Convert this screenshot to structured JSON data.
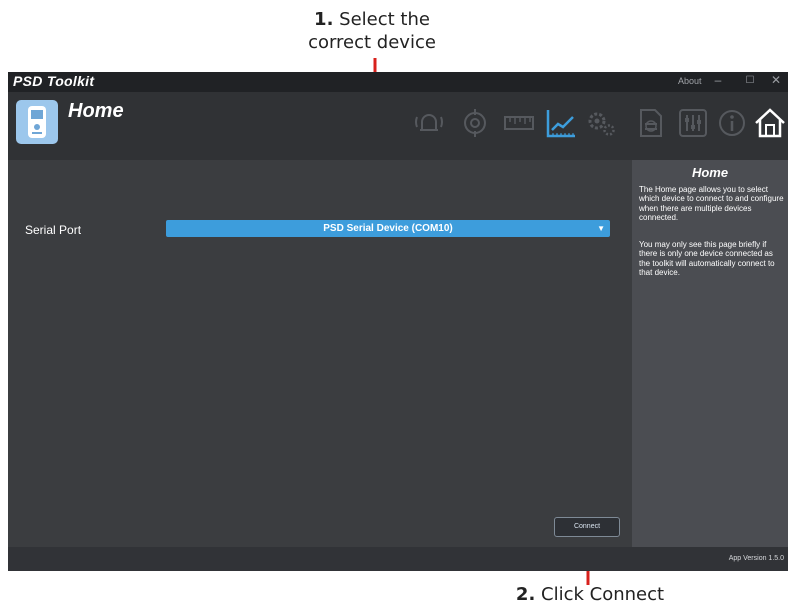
{
  "annotations": {
    "top_step": "1.",
    "top_line1": " Select the",
    "top_line2": "correct device",
    "bottom_step": "2.",
    "bottom_text": " Click Connect"
  },
  "app": {
    "title": "PSD Toolkit",
    "about": "About",
    "minimize_glyph": "–",
    "maximize_glyph": "☐",
    "close_glyph": "✕",
    "page_title": "Home",
    "version": "App Version 1.5.0"
  },
  "toolbar": {
    "icons": [
      "alarm-icon",
      "target-icon",
      "ruler-icon",
      "chart-icon",
      "gears-icon",
      "document-icon",
      "sliders-icon",
      "info-icon",
      "home-icon"
    ]
  },
  "main": {
    "serial_label": "Serial Port",
    "serial_value": "PSD Serial Device (COM10)",
    "connect_label": "Connect"
  },
  "help": {
    "title": "Home",
    "paragraph1": "The Home page allows you to select which device to connect to and configure when there are multiple devices connected.",
    "paragraph2": "You may only see this page briefly if there is only one device connected as the toolkit will automatically connect to that device."
  },
  "colors": {
    "accent_select": "#3d9ddc",
    "arrow": "#d8211c",
    "background": "#3b3d40",
    "side_panel": "#4b4d52"
  }
}
